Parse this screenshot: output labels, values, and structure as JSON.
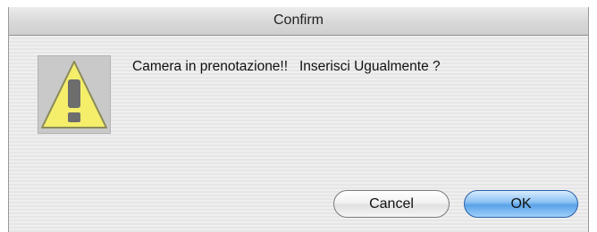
{
  "dialog": {
    "title": "Confirm",
    "message": "Camera in prenotazione!!   Inserisci Ugualmente ?",
    "icon": "warning-icon"
  },
  "buttons": {
    "cancel_label": "Cancel",
    "ok_label": "OK"
  },
  "colors": {
    "warning_fill": "#f4ee6a",
    "default_button": "#5aa3e8"
  }
}
